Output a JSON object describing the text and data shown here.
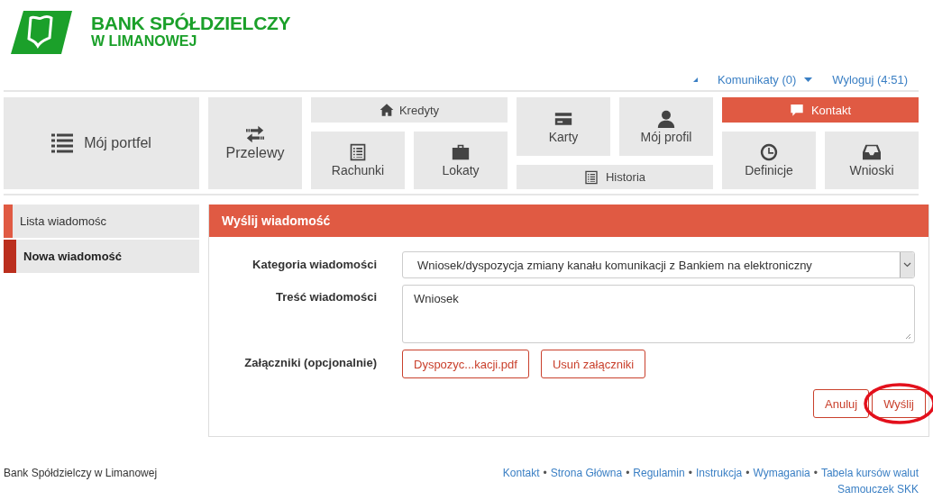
{
  "brand": {
    "name": "BANK SPÓŁDZIELCZY",
    "subtitle": "W LIMANOWEJ"
  },
  "top_links": [
    {
      "label": "Komunikaty (0)",
      "dropdown": true
    },
    {
      "label": "Wyloguj (4:51)",
      "dropdown": false
    }
  ],
  "nav": {
    "tiles": [
      {
        "label": "Mój portfel",
        "selected": false
      },
      {
        "label": "Przelewy",
        "selected": false
      },
      {
        "label": "Kredyty",
        "selected": false
      },
      {
        "label": "Karty",
        "selected": false
      },
      {
        "label": "Mój profil",
        "selected": false
      },
      {
        "label": "Kontakt",
        "selected": true
      },
      {
        "label": "Rachunki",
        "selected": false
      },
      {
        "label": "Lokaty",
        "selected": false
      },
      {
        "label": "Historia",
        "selected": false
      },
      {
        "label": "Definicje",
        "selected": false
      },
      {
        "label": "Wnioski",
        "selected": false
      }
    ]
  },
  "sidebar": {
    "items": [
      {
        "label": "Lista wiadomośc",
        "selected": false
      },
      {
        "label": "Nowa wiadomość",
        "selected": true
      }
    ]
  },
  "panel": {
    "title": "Wyślij wiadomość",
    "fields": [
      {
        "kind": "select",
        "label": "Kategoria wiadomości",
        "value": "Wniosek/dyspozycja zmiany kanału komunikacji z Bankiem na elektroniczny"
      },
      {
        "kind": "textarea",
        "label": "Treść wiadomości",
        "value": "Wniosek"
      },
      {
        "kind": "attachments",
        "label": "Załączniki (opcjonalnie)",
        "buttons": [
          "Dyspozyc...kacji.pdf",
          "Usuń załączniki"
        ]
      }
    ],
    "actions": [
      {
        "label": "Anuluj",
        "highlighted": false
      },
      {
        "label": "Wyślij",
        "highlighted": true
      }
    ]
  },
  "footer": {
    "text": "Bank Spółdzielczy w Limanowej",
    "separator": "•",
    "links": [
      "Kontakt",
      "Strona Główna",
      "Regulamin",
      "Instrukcja",
      "Wymagania",
      "Tabela kursów walut",
      "Samouczek SKK"
    ]
  }
}
